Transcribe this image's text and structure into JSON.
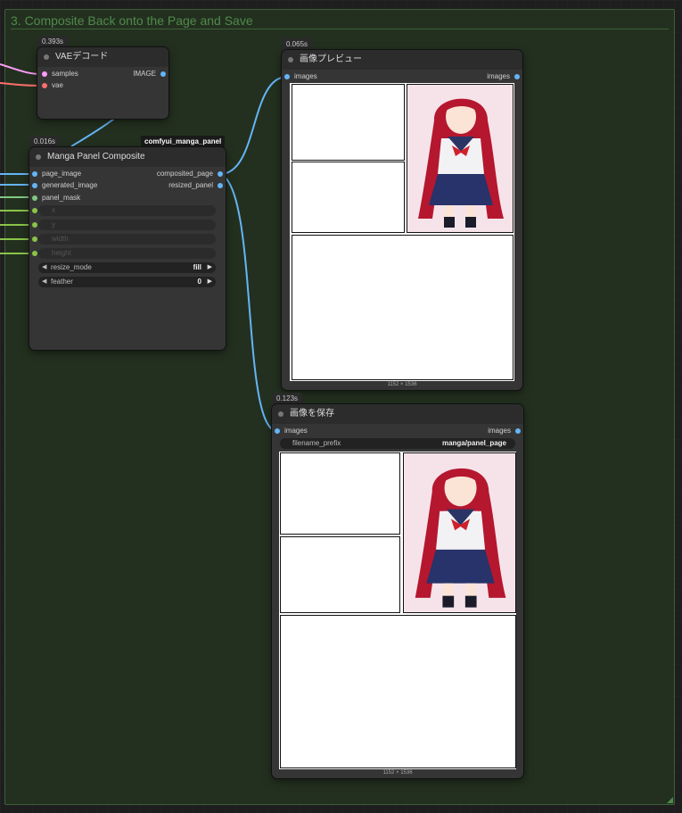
{
  "group": {
    "title": "3. Composite Back onto the Page and Save"
  },
  "nodes": {
    "vae_decode": {
      "timing": "0.393s",
      "title": "VAEデコード",
      "inputs": [
        "samples",
        "vae"
      ],
      "output": "IMAGE"
    },
    "manga_composite": {
      "timing": "0.016s",
      "badge": "comfyui_manga_panel",
      "title": "Manga Panel Composite",
      "inputs": [
        "page_image",
        "generated_image",
        "panel_mask",
        "x",
        "y",
        "width",
        "height"
      ],
      "outputs": [
        "composited_page",
        "resized_panel"
      ],
      "widgets": {
        "resize_mode": {
          "label": "resize_mode",
          "value": "fill"
        },
        "feather": {
          "label": "feather",
          "value": "0"
        }
      }
    },
    "preview": {
      "timing": "0.065s",
      "title": "画像プレビュー",
      "input": "images",
      "output": "images",
      "caption": "1152 × 1536"
    },
    "save": {
      "timing": "0.123s",
      "title": "画像を保存",
      "input": "images",
      "output": "images",
      "filename": {
        "label": "filename_prefix",
        "value": "manga/panel_page"
      },
      "caption": "1152 × 1536"
    }
  },
  "colors": {
    "image_link": "#64b5f6",
    "latent_link": "#ff9cf9",
    "vae_link": "#ff6e6e",
    "mask_link": "#81c784",
    "int_link": "#8bc34a",
    "group_border": "#3d5f39",
    "group_fill": "#23301f"
  }
}
